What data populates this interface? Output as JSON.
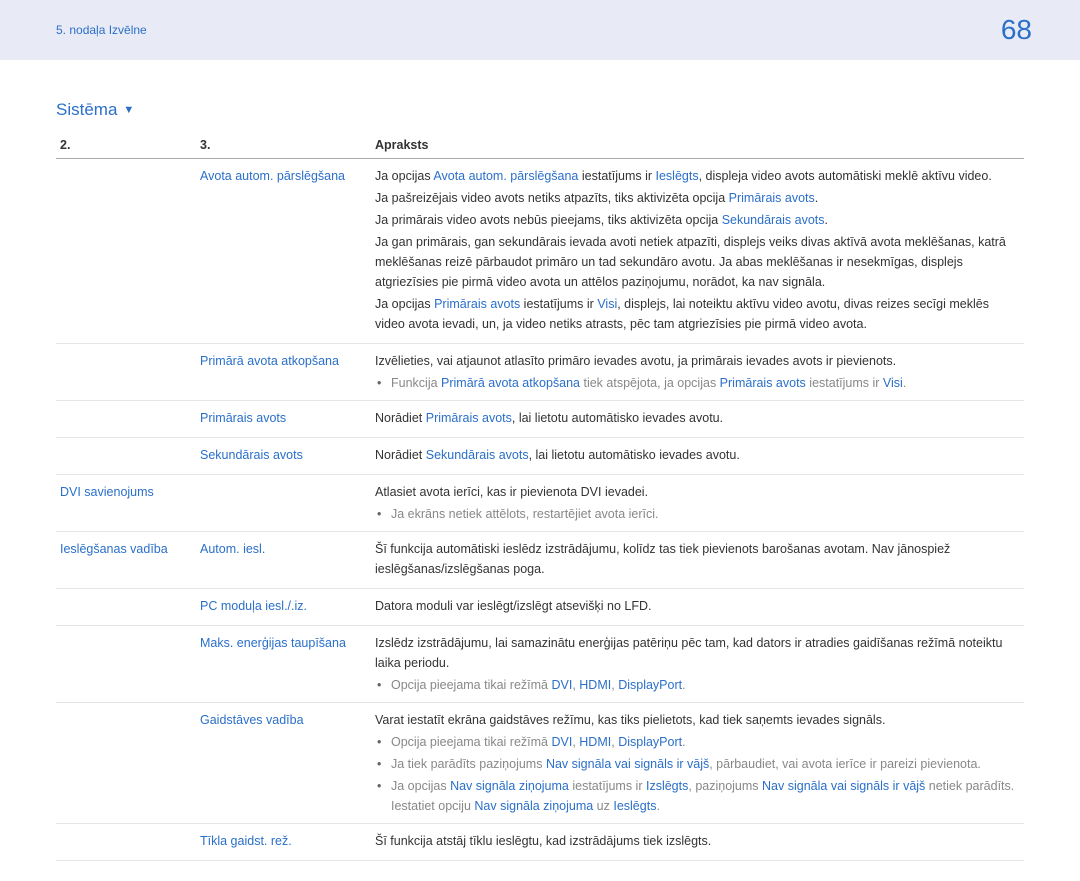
{
  "header": {
    "breadcrumb": "5. nodaļa Izvēlne",
    "page_number": "68"
  },
  "section": {
    "title": "Sistēma"
  },
  "table": {
    "head": {
      "c1": "2.",
      "c2": "3.",
      "c3": "Apraksts"
    },
    "rows": [
      {
        "c1": "",
        "c2": "Avota autom. pārslēgšana",
        "desc": {
          "p1a": "Ja opcijas ",
          "p1b": "Avota autom. pārslēgšana",
          "p1c": " iestatījums ir ",
          "p1d": "Ieslēgts",
          "p1e": ", displeja video avots automātiski meklē aktīvu video.",
          "p2a": "Ja pašreizējais video avots netiks atpazīts, tiks aktivizēta opcija ",
          "p2b": "Primārais avots",
          "p2c": ".",
          "p3a": "Ja primārais video avots nebūs pieejams, tiks aktivizēta opcija ",
          "p3b": "Sekundārais avots",
          "p3c": ".",
          "p4": "Ja gan primārais, gan sekundārais ievada avoti netiek atpazīti, displejs veiks divas aktīvā avota meklēšanas, katrā meklēšanas reizē pārbaudot primāro un tad sekundāro avotu. Ja abas meklēšanas ir nesekmīgas, displejs atgriezīsies pie pirmā video avota un attēlos paziņojumu, norādot, ka nav signāla.",
          "p5a": "Ja opcijas ",
          "p5b": "Primārais avots",
          "p5c": " iestatījums ir ",
          "p5d": "Visi",
          "p5e": ", displejs, lai noteiktu aktīvu video avotu, divas reizes secīgi meklēs video avota ievadi, un, ja video netiks atrasts, pēc tam atgriezīsies pie pirmā video avota."
        }
      },
      {
        "c1": "",
        "c2": "Primārā avota atkopšana",
        "desc": {
          "p1": "Izvēlieties, vai atjaunot atlasīto primāro ievades avotu, ja primārais ievades avots ir pievienots.",
          "b1a": "Funkcija ",
          "b1b": "Primārā avota atkopšana",
          "b1c": " tiek atspējota, ja opcijas ",
          "b1d": "Primārais avots",
          "b1e": " iestatījums ir ",
          "b1f": "Visi",
          "b1g": "."
        }
      },
      {
        "c1": "",
        "c2": "Primārais avots",
        "desc": {
          "p1a": "Norādiet ",
          "p1b": "Primārais avots",
          "p1c": ", lai lietotu automātisko ievades avotu."
        }
      },
      {
        "c1": "",
        "c2": "Sekundārais avots",
        "desc": {
          "p1a": "Norādiet ",
          "p1b": "Sekundārais avots",
          "p1c": ", lai lietotu automātisko ievades avotu."
        }
      },
      {
        "c1": "DVI savienojums",
        "c2": "",
        "desc": {
          "p1": "Atlasiet avota ierīci, kas ir pievienota DVI ievadei.",
          "b1": "Ja ekrāns netiek attēlots, restartējiet avota ierīci."
        }
      },
      {
        "c1": "Ieslēgšanas vadība",
        "c2": "Autom. iesl.",
        "desc": {
          "p1": "Šī funkcija automātiski ieslēdz izstrādājumu, kolīdz tas tiek pievienots barošanas avotam. Nav jānospiež ieslēgšanas/izslēgšanas poga."
        }
      },
      {
        "c1": "",
        "c2": "PC moduļa iesl./.iz.",
        "desc": {
          "p1": "Datora moduli var ieslēgt/izslēgt atsevišķi no LFD."
        }
      },
      {
        "c1": "",
        "c2": "Maks. enerģijas taupīšana",
        "desc": {
          "p1": "Izslēdz izstrādājumu, lai samazinātu enerģijas patēriņu pēc tam, kad dators ir atradies gaidīšanas režīmā noteiktu laika periodu.",
          "b1a": "Opcija pieejama tikai režīmā ",
          "b1b": "DVI",
          "b1c": ", ",
          "b1d": "HDMI",
          "b1e": ", ",
          "b1f": "DisplayPort",
          "b1g": "."
        }
      },
      {
        "c1": "",
        "c2": "Gaidstāves vadība",
        "desc": {
          "p1": "Varat iestatīt ekrāna gaidstāves režīmu, kas tiks pielietots, kad tiek saņemts ievades signāls.",
          "b1a": "Opcija pieejama tikai režīmā ",
          "b1b": "DVI",
          "b1c": ", ",
          "b1d": "HDMI",
          "b1e": ", ",
          "b1f": "DisplayPort",
          "b1g": ".",
          "b2a": "Ja tiek parādīts paziņojums ",
          "b2b": "Nav signāla vai signāls ir vājš",
          "b2c": ", pārbaudiet, vai avota ierīce ir pareizi pievienota.",
          "b3a": "Ja opcijas ",
          "b3b": "Nav signāla ziņojuma",
          "b3c": " iestatījums ir ",
          "b3d": "Izslēgts",
          "b3e": ", paziņojums ",
          "b3f": "Nav signāla vai signāls ir vājš",
          "b3g": " netiek parādīts. Iestatiet opciju ",
          "b3h": "Nav signāla ziņojuma",
          "b3i": " uz ",
          "b3j": "Ieslēgts",
          "b3k": "."
        }
      },
      {
        "c1": "",
        "c2": "Tīkla gaidst. rež.",
        "desc": {
          "p1": "Šī funkcija atstāj tīklu ieslēgtu, kad izstrādājums tiek izslēgts."
        }
      }
    ]
  }
}
